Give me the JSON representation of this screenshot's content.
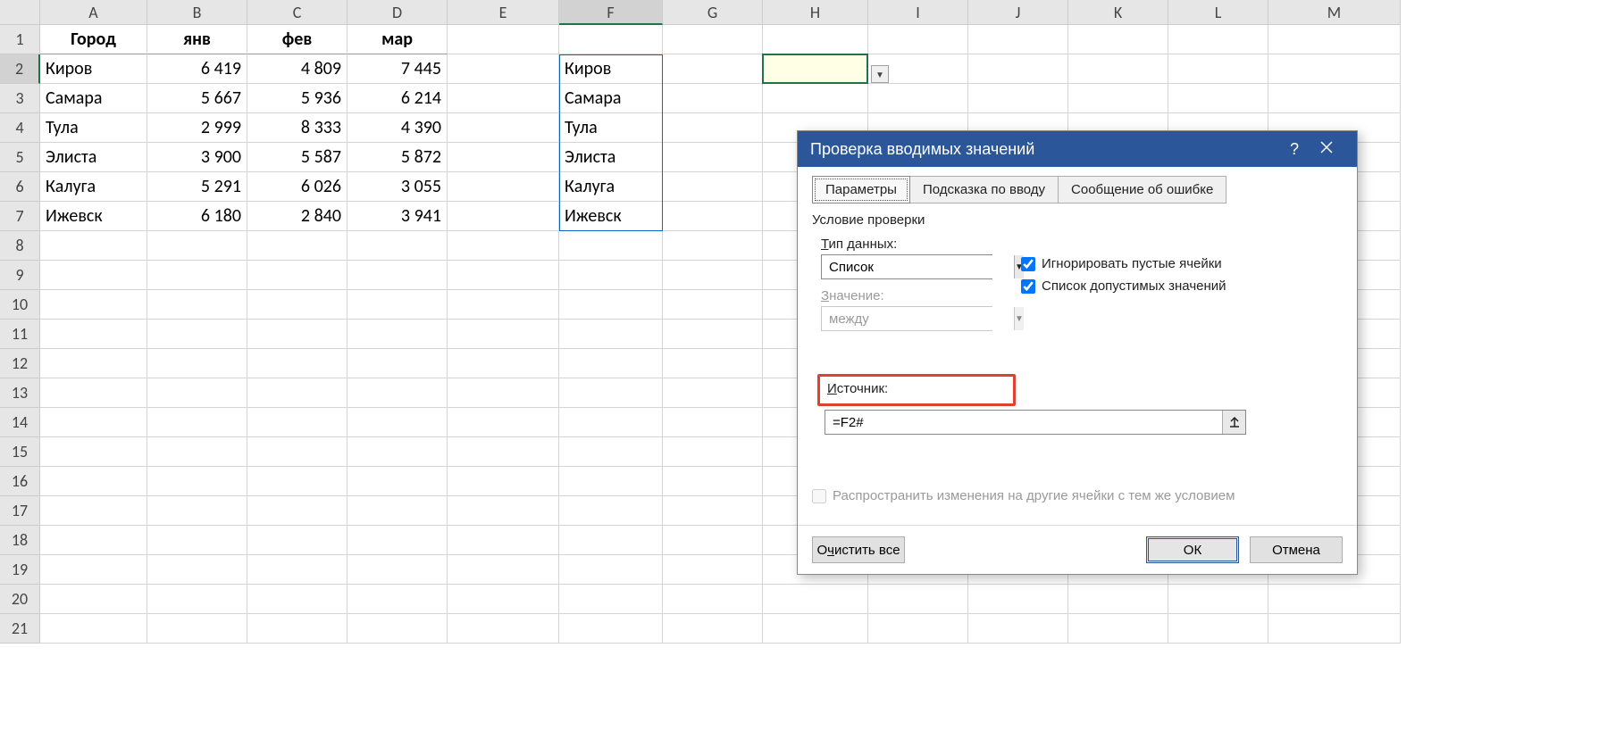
{
  "columns": [
    "A",
    "B",
    "C",
    "D",
    "E",
    "F",
    "G",
    "H",
    "I",
    "J",
    "K",
    "L",
    "M"
  ],
  "rowsShown": 21,
  "table": {
    "headers": {
      "A": "Город",
      "B": "янв",
      "C": "фев",
      "D": "мар"
    },
    "rows": [
      {
        "A": "Киров",
        "B": "6 419",
        "C": "4 809",
        "D": "7 445"
      },
      {
        "A": "Самара",
        "B": "5 667",
        "C": "5 936",
        "D": "6 214"
      },
      {
        "A": "Тула",
        "B": "2 999",
        "C": "8 333",
        "D": "4 390"
      },
      {
        "A": "Элиста",
        "B": "3 900",
        "C": "5 587",
        "D": "5 872"
      },
      {
        "A": "Калуга",
        "B": "5 291",
        "C": "6 026",
        "D": "3 055"
      },
      {
        "A": "Ижевск",
        "B": "6 180",
        "C": "2 840",
        "D": "3 941"
      }
    ]
  },
  "spill": [
    "Киров",
    "Самара",
    "Тула",
    "Элиста",
    "Калуга",
    "Ижевск"
  ],
  "dialog": {
    "title": "Проверка вводимых значений",
    "tabs": {
      "params": "Параметры",
      "input_msg": "Подсказка по вводу",
      "error_msg": "Сообщение об ошибке"
    },
    "group": "Условие проверки",
    "data_type_label_pre": "Т",
    "data_type_label": "ип данных:",
    "data_type_value": "Список",
    "value_label_pre": "З",
    "value_label": "начение:",
    "value_value": "между",
    "ignore_blank_pre": "И",
    "ignore_blank": "гнорировать пустые ячейки",
    "in_cell_pre": "С",
    "in_cell": "писок допустимых значений",
    "source_label_pre": "И",
    "source_label": "сточник:",
    "source_value": "=F2#",
    "propagate_pre": "Р",
    "propagate": "аспространить изменения на другие ячейки с тем же условием",
    "clear_pre": "ч",
    "clear_before": "О",
    "clear_after": "истить все",
    "ok": "ОК",
    "cancel": "Отмена"
  }
}
